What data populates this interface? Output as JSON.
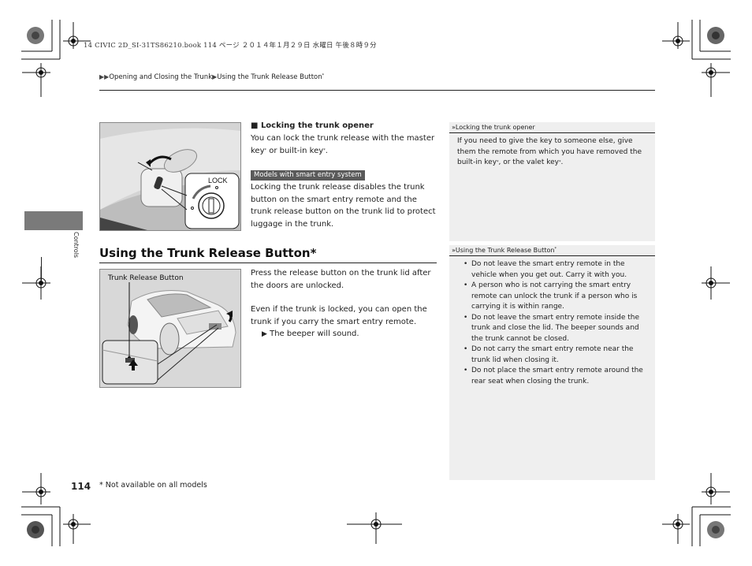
{
  "print_info": "14 CIVIC 2D_SI-31TS86210.book  114 ページ  ２０１４年１月２９日  水曜日  午後８時９分",
  "breadcrumb": {
    "prefix_icon": "double-triangle-right-icon",
    "items": [
      "Opening and Closing the Trunk",
      "Using the Trunk Release Button"
    ],
    "separator_icon": "triangle-right-icon",
    "asterisk": "*"
  },
  "side_tab": {
    "label": "Controls",
    "color": "#7a7a7a"
  },
  "section1": {
    "heading": "Locking the trunk opener",
    "heading_icon": "black-square-icon",
    "text_before": "You can lock the trunk release with the master key",
    "text_mid": " or built-in key",
    "text_end": ".",
    "star": "*",
    "badge": "Models with smart entry system",
    "paragraph2": "Locking the trunk release disables the trunk button on the smart entry remote and the trunk release button on the trunk lid to protect luggage in the trunk.",
    "image_label": "LOCK"
  },
  "section2": {
    "heading": "Using the Trunk Release Button",
    "heading_star": "*",
    "image_label": "Trunk Release Button",
    "paragraph1": "Press the release button on the trunk lid after the doors are unlocked.",
    "paragraph2": "Even if the trunk is locked, you can open the trunk if you carry the smart entry remote.",
    "result_icon": "triangle-right-icon",
    "result": "The beeper will sound."
  },
  "notes": [
    {
      "title": "Locking the trunk opener",
      "text_a": "If you need to give the key to someone else, give them the remote from which you have removed the built-in key",
      "text_b": ", or the valet key",
      "text_c": ".",
      "star": "*"
    },
    {
      "title": "Using the Trunk Release Button",
      "title_star": "*",
      "bullets": [
        "Do not leave the smart entry remote in the vehicle when you get out. Carry it with you.",
        "A person who is not carrying the smart entry remote can unlock the trunk if a person who is carrying it is within range.",
        "Do not leave the smart entry remote inside the trunk and close the lid. The beeper sounds and the trunk cannot be closed.",
        "Do not carry the smart entry remote near the trunk lid when closing it.",
        "Do not place the smart entry remote around the rear seat when closing the trunk."
      ]
    }
  ],
  "footer": {
    "page_number": "114",
    "footnote": "* Not available on all models"
  },
  "note_icon": "double-chevron-right-icon",
  "note_bg": "#efefef"
}
